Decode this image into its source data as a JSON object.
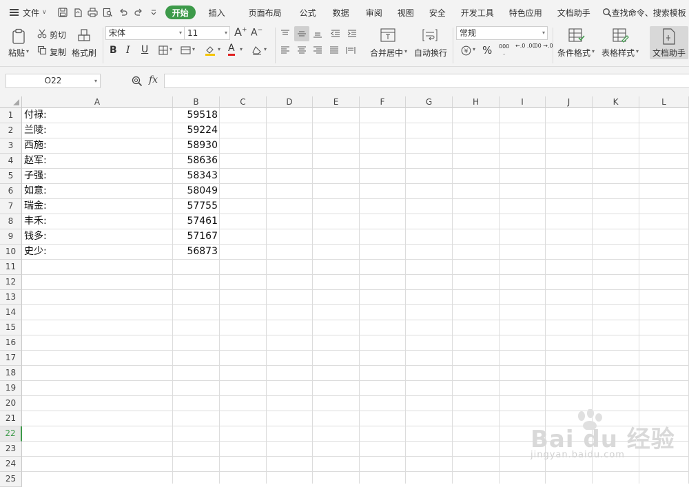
{
  "menubar": {
    "file": "文件",
    "tabs": [
      "插入",
      "页面布局",
      "公式",
      "数据",
      "审阅",
      "视图",
      "安全",
      "开发工具",
      "特色应用",
      "文档助手"
    ],
    "home_tab": "开始",
    "search": "查找命令、搜索模板"
  },
  "ribbon": {
    "paste": "粘贴",
    "cut": "剪切",
    "copy": "复制",
    "format_painter": "格式刷",
    "font_name": "宋体",
    "font_size": "11",
    "bold": "B",
    "italic": "I",
    "underline": "U",
    "font_color_letter": "A",
    "merge_center": "合并居中",
    "wrap_text": "自动换行",
    "number_format": "常规",
    "percent": "%",
    "thousands": "000",
    "inc_decimal": "←.0 .00",
    "dec_decimal": ".00 →.0",
    "conditional_format": "条件格式",
    "table_style": "表格样式",
    "doc_assistant": "文档助手",
    "accent_color": "#3d9a4a"
  },
  "formula_bar": {
    "name_box": "O22",
    "fx": "fx"
  },
  "columns": [
    "A",
    "B",
    "C",
    "D",
    "E",
    "F",
    "G",
    "H",
    "I",
    "J",
    "K",
    "L"
  ],
  "rows": [
    "1",
    "2",
    "3",
    "4",
    "5",
    "6",
    "7",
    "8",
    "9",
    "10",
    "11",
    "12",
    "13",
    "14",
    "15",
    "16",
    "17",
    "18",
    "19",
    "20",
    "21",
    "22",
    "23",
    "24",
    "25"
  ],
  "active_row": "22",
  "cells": [
    {
      "name": "付禄:",
      "value": "59518"
    },
    {
      "name": "兰陵:",
      "value": "59224"
    },
    {
      "name": "西施:",
      "value": "58930"
    },
    {
      "name": "赵军:",
      "value": "58636"
    },
    {
      "name": "子强:",
      "value": "58343"
    },
    {
      "name": "如意:",
      "value": "58049"
    },
    {
      "name": "瑞金:",
      "value": "57755"
    },
    {
      "name": "丰禾:",
      "value": "57461"
    },
    {
      "name": "钱多:",
      "value": "57167"
    },
    {
      "name": "史少:",
      "value": "56873"
    }
  ],
  "watermark": {
    "brand": "Bai du 经验",
    "url": "jingyan.baidu.com"
  }
}
